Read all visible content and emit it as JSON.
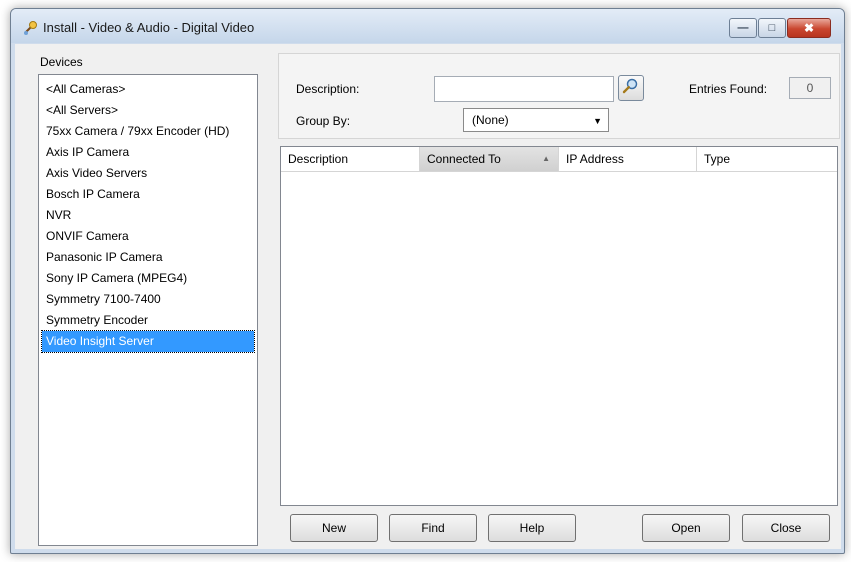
{
  "window": {
    "title": "Install - Video & Audio - Digital Video"
  },
  "devices": {
    "label": "Devices",
    "items": [
      "<All Cameras>",
      "<All Servers>",
      "75xx Camera / 79xx Encoder (HD)",
      "Axis IP Camera",
      "Axis Video Servers",
      "Bosch IP Camera",
      "NVR",
      "ONVIF Camera",
      "Panasonic IP Camera",
      "Sony IP Camera (MPEG4)",
      "Symmetry 7100-7400",
      "Symmetry Encoder",
      "Video Insight Server"
    ],
    "selected": "Video Insight Server"
  },
  "filter": {
    "description_label": "Description:",
    "description_value": "",
    "entries_label": "Entries Found:",
    "entries_count": "0",
    "groupby_label": "Group By:",
    "groupby_value": "(None)"
  },
  "grid": {
    "columns": [
      "Description",
      "Connected To",
      "IP Address",
      "Type"
    ],
    "sorted_column": "Connected To",
    "rows": []
  },
  "buttons": {
    "new": "New",
    "find": "Find",
    "help": "Help",
    "open": "Open",
    "close": "Close"
  }
}
